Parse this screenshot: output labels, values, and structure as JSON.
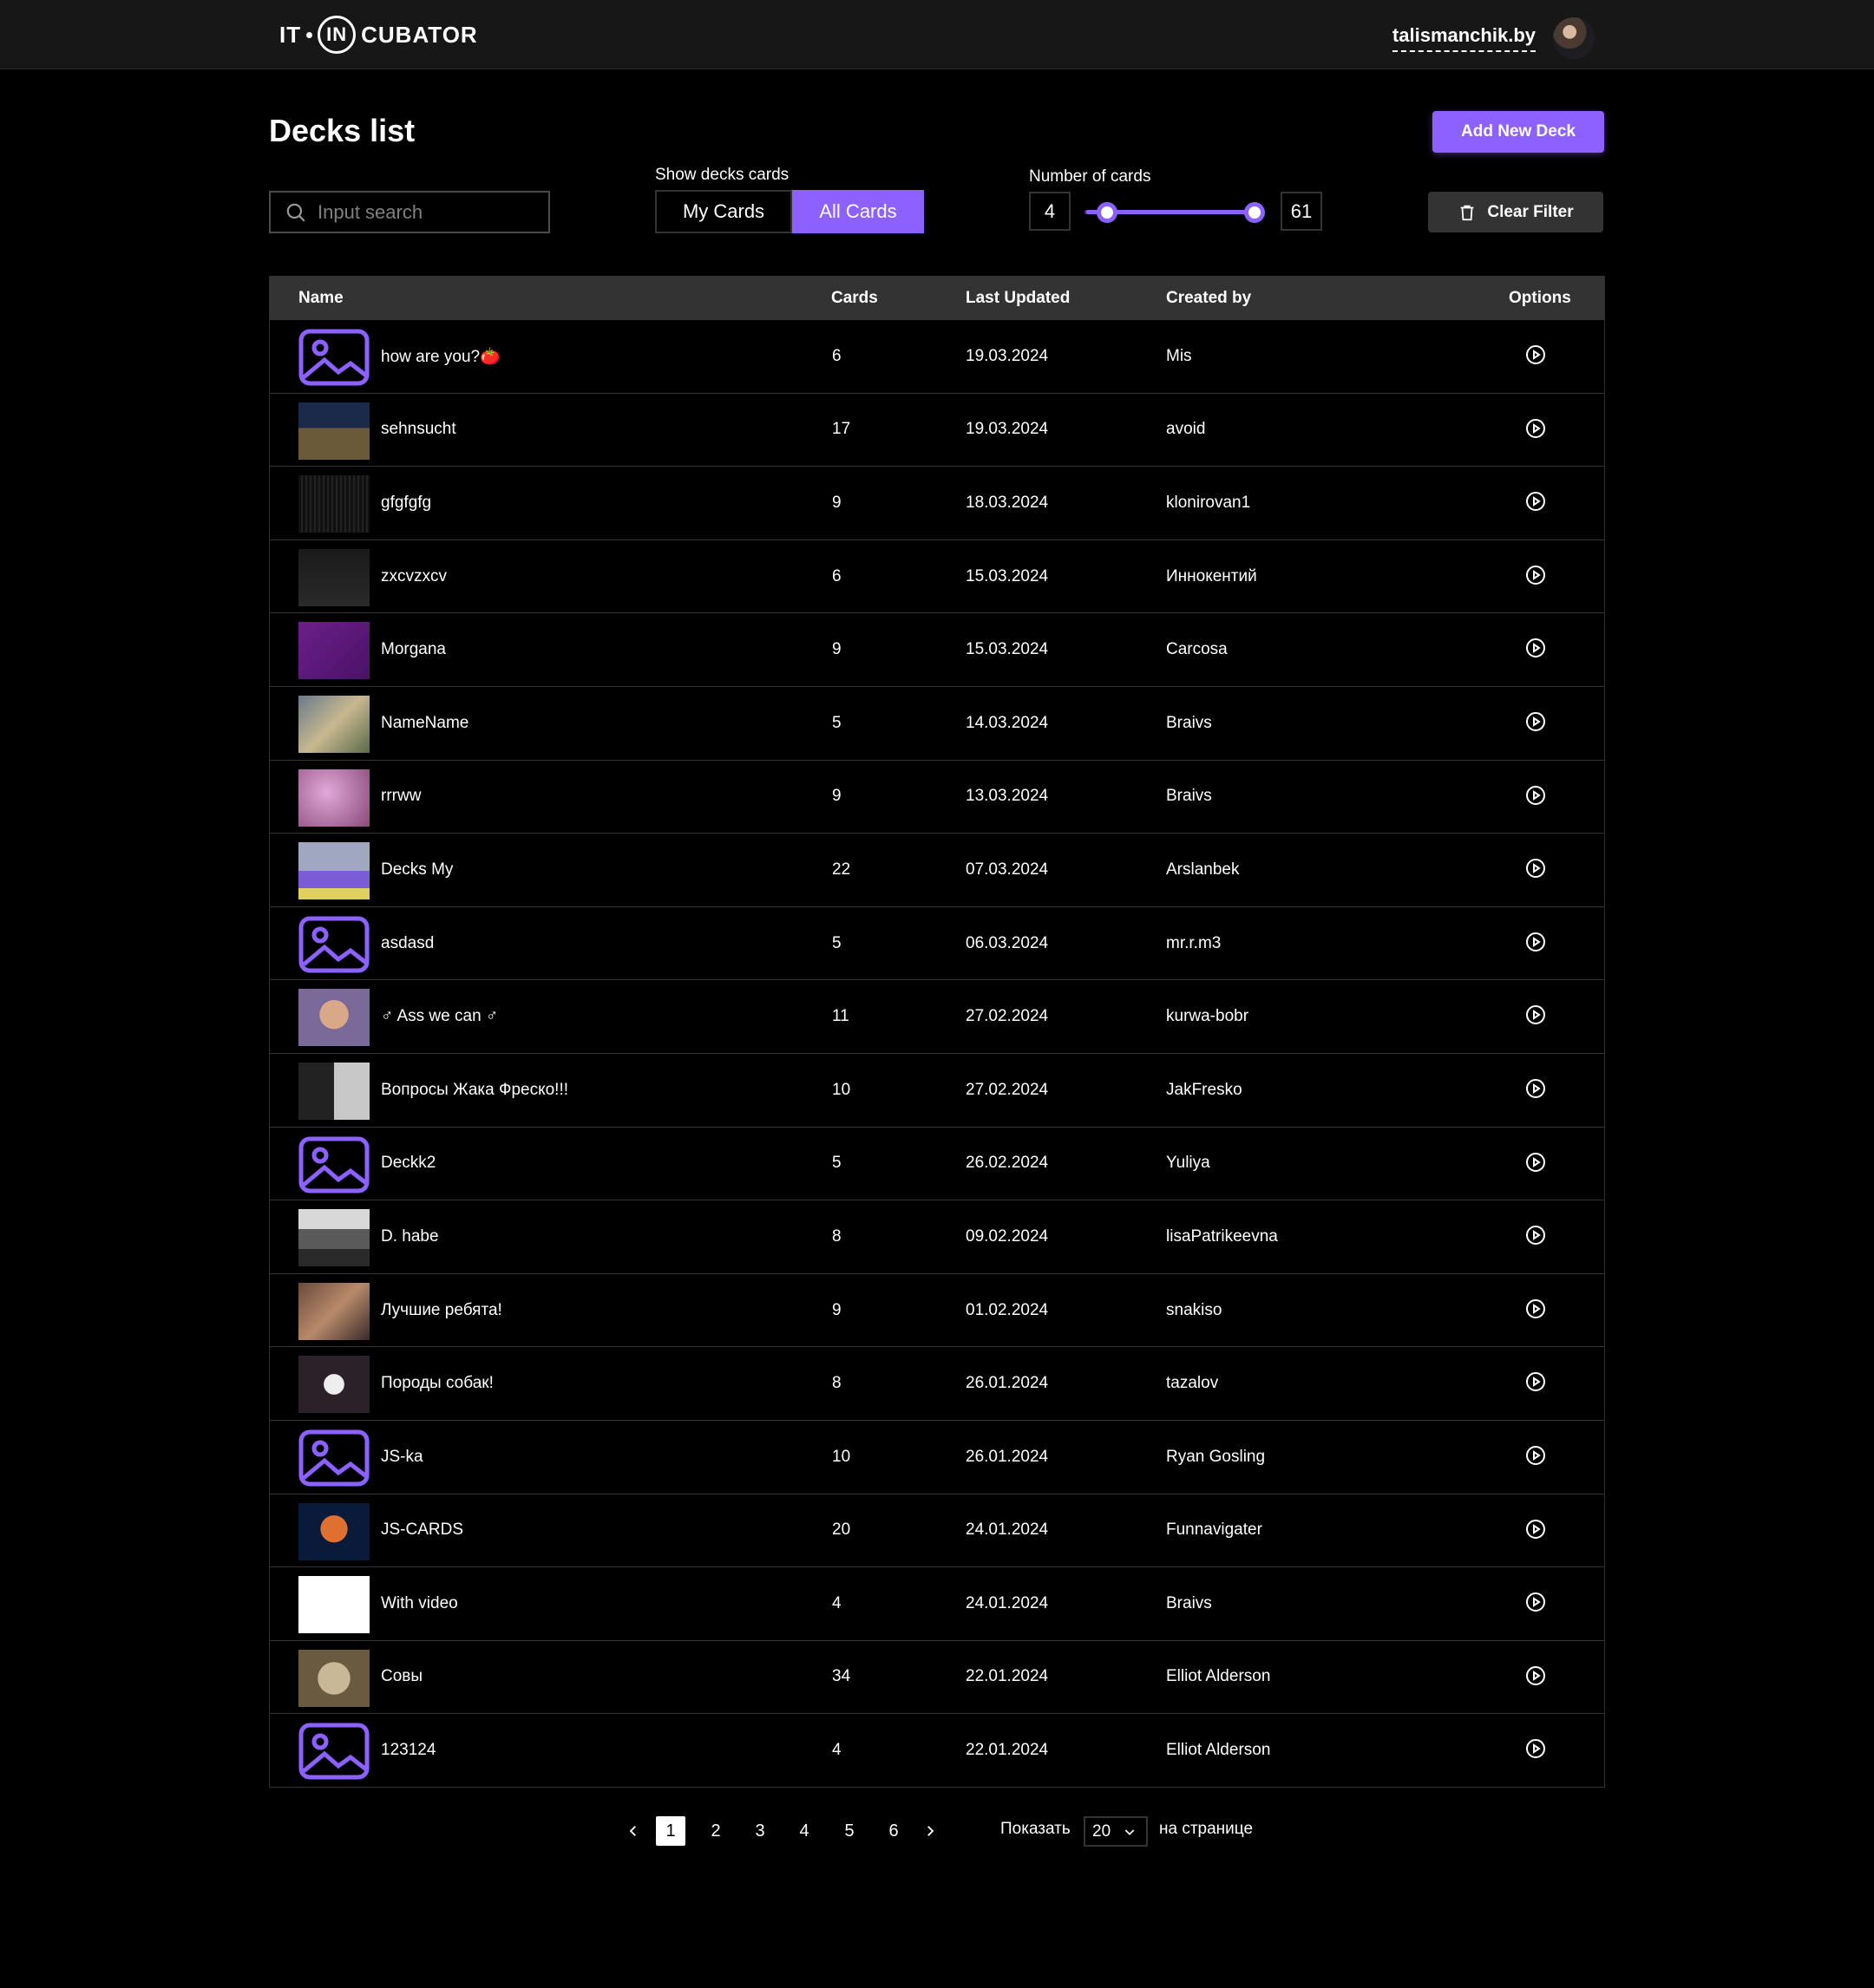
{
  "header": {
    "logo_left": "IT",
    "logo_in": "IN",
    "logo_right": "CUBATOR",
    "username": "talismanchik.by"
  },
  "page": {
    "title": "Decks list",
    "add_button": "Add New Deck"
  },
  "filters": {
    "search_placeholder": "Input search",
    "toggle_label": "Show decks cards",
    "toggle_options": [
      "My Cards",
      "All Cards"
    ],
    "toggle_selected": "All Cards",
    "range_label": "Number of cards",
    "range_min": "4",
    "range_max": "61",
    "clear_button": "Clear Filter"
  },
  "table": {
    "columns": {
      "name": "Name",
      "cards": "Cards",
      "updated": "Last Updated",
      "created": "Created by",
      "options": "Options"
    },
    "rows": [
      {
        "name": "how are you?🍅",
        "cards": "6",
        "updated": "19.03.2024",
        "author": "Mis",
        "thumb": "placeholder"
      },
      {
        "name": "sehnsucht",
        "cards": "17",
        "updated": "19.03.2024",
        "author": "avoid",
        "thumb": "photo"
      },
      {
        "name": "gfgfgfg",
        "cards": "9",
        "updated": "18.03.2024",
        "author": "klonirovan1",
        "thumb": "dark"
      },
      {
        "name": "zxcvzxcv",
        "cards": "6",
        "updated": "15.03.2024",
        "author": "Иннокентий",
        "thumb": "dark2"
      },
      {
        "name": "Morgana",
        "cards": "9",
        "updated": "15.03.2024",
        "author": "Carcosa",
        "thumb": "purple"
      },
      {
        "name": "NameName",
        "cards": "5",
        "updated": "14.03.2024",
        "author": "Braivs",
        "thumb": "photo2"
      },
      {
        "name": "rrrww",
        "cards": "9",
        "updated": "13.03.2024",
        "author": "Braivs",
        "thumb": "pink"
      },
      {
        "name": "Decks My",
        "cards": "22",
        "updated": "07.03.2024",
        "author": "Arslanbek",
        "thumb": "photo3"
      },
      {
        "name": "asdasd",
        "cards": "5",
        "updated": "06.03.2024",
        "author": "mr.r.m3",
        "thumb": "placeholder"
      },
      {
        "name": "♂ Ass we can ♂",
        "cards": "11",
        "updated": "27.02.2024",
        "author": "kurwa-bobr",
        "thumb": "photo4"
      },
      {
        "name": "Вопросы Жака Фреско!!!",
        "cards": "10",
        "updated": "27.02.2024",
        "author": "JakFresko",
        "thumb": "photo5"
      },
      {
        "name": "Deckk2",
        "cards": "5",
        "updated": "26.02.2024",
        "author": "Yuliya",
        "thumb": "placeholder"
      },
      {
        "name": "D. habe",
        "cards": "8",
        "updated": "09.02.2024",
        "author": "lisaPatrikeevna",
        "thumb": "photo6"
      },
      {
        "name": "Лучшие ребята!",
        "cards": "9",
        "updated": "01.02.2024",
        "author": "snakiso",
        "thumb": "photo7"
      },
      {
        "name": "Породы собак!",
        "cards": "8",
        "updated": "26.01.2024",
        "author": "tazalov",
        "thumb": "photo8"
      },
      {
        "name": "JS-ka",
        "cards": "10",
        "updated": "26.01.2024",
        "author": "Ryan Gosling",
        "thumb": "placeholder"
      },
      {
        "name": "JS-CARDS",
        "cards": "20",
        "updated": "24.01.2024",
        "author": "Funnavigater",
        "thumb": "photo9"
      },
      {
        "name": "With video",
        "cards": "4",
        "updated": "24.01.2024",
        "author": "Braivs",
        "thumb": "white"
      },
      {
        "name": "Совы",
        "cards": "34",
        "updated": "22.01.2024",
        "author": "Elliot Alderson",
        "thumb": "photo10"
      },
      {
        "name": "123124",
        "cards": "4",
        "updated": "22.01.2024",
        "author": "Elliot Alderson",
        "thumb": "placeholder"
      }
    ]
  },
  "pagination": {
    "pages": [
      "1",
      "2",
      "3",
      "4",
      "5",
      "6"
    ],
    "current": "1",
    "show_label": "Показать",
    "per_page": "20",
    "per_page_suffix": "на странице"
  },
  "colors": {
    "accent": "#8c61ff",
    "background": "#000000",
    "header": "#171717",
    "border": "#333333"
  },
  "icons": {
    "search": "search-icon",
    "trash": "trash-icon",
    "options": "play-circle-icon",
    "prev": "chevron-left-icon",
    "next": "chevron-right-icon",
    "dropdown": "chevron-down-icon"
  }
}
